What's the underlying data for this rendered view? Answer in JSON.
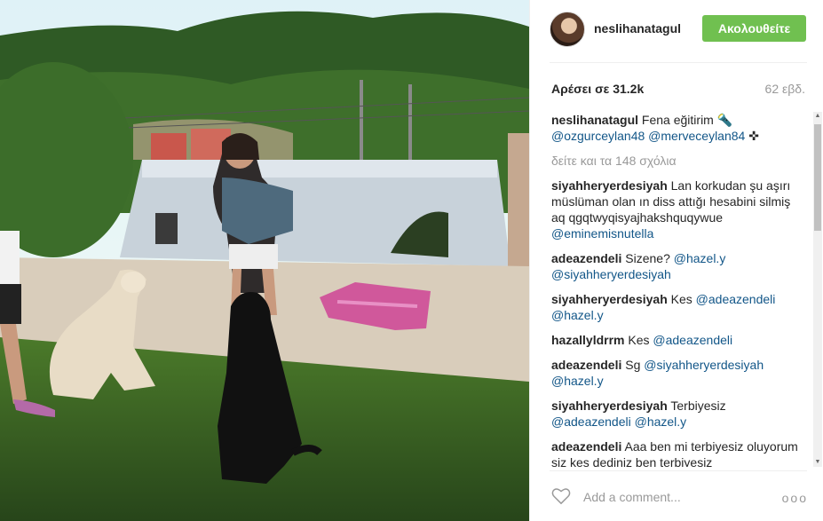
{
  "post": {
    "username": "neslihanatagul",
    "follow_label": "Ακολουθείτε",
    "likes": "Αρέσει σε 31.2k",
    "age": "62 εβδ.",
    "caption": {
      "user": "neslihanatagul",
      "text": "Fena eğitirim",
      "emoji1": "🔦",
      "mention1": "@ozgurceylan48",
      "mention2": "@merveceylan84",
      "emoji2": "✜"
    },
    "more_comments": "δείτε και τα 148 σχόλια",
    "comments": [
      {
        "user": "siyahheryerdesiyah",
        "text": "Lan korkudan şu aşırı müslüman olan ın diss attığı hesabini silmiş aq qgqtwyqisyajhakshquqywue",
        "mentions": "@eminemisnutella"
      },
      {
        "user": "adeazendeli",
        "text": "Sizene?",
        "mentions": "@hazel.y @siyahheryerdesiyah"
      },
      {
        "user": "siyahheryerdesiyah",
        "text": "Kes",
        "mentions": "@adeazendeli @hazel.y"
      },
      {
        "user": "hazallyldrrm",
        "text": "Kes",
        "mentions": "@adeazendeli"
      },
      {
        "user": "adeazendeli",
        "text": "Sg",
        "mentions": "@siyahheryerdesiyah @hazel.y"
      },
      {
        "user": "siyahheryerdesiyah",
        "text": "Terbiyesiz",
        "mentions": "@adeazendeli @hazel.y"
      },
      {
        "user": "adeazendeli",
        "text": "Aaa ben mi terbiyesiz oluyorum siz kes dediniz ben terbiyesiz",
        "mentions": ""
      }
    ],
    "add_comment_placeholder": "Add a comment...",
    "more_options": "ooo"
  },
  "icons": {
    "heart": "heart-icon",
    "more": "more-options-icon",
    "scroll_up": "▲",
    "scroll_down": "▼"
  },
  "colors": {
    "follow_button": "#70c050",
    "mention": "#125688",
    "muted": "#999999"
  }
}
